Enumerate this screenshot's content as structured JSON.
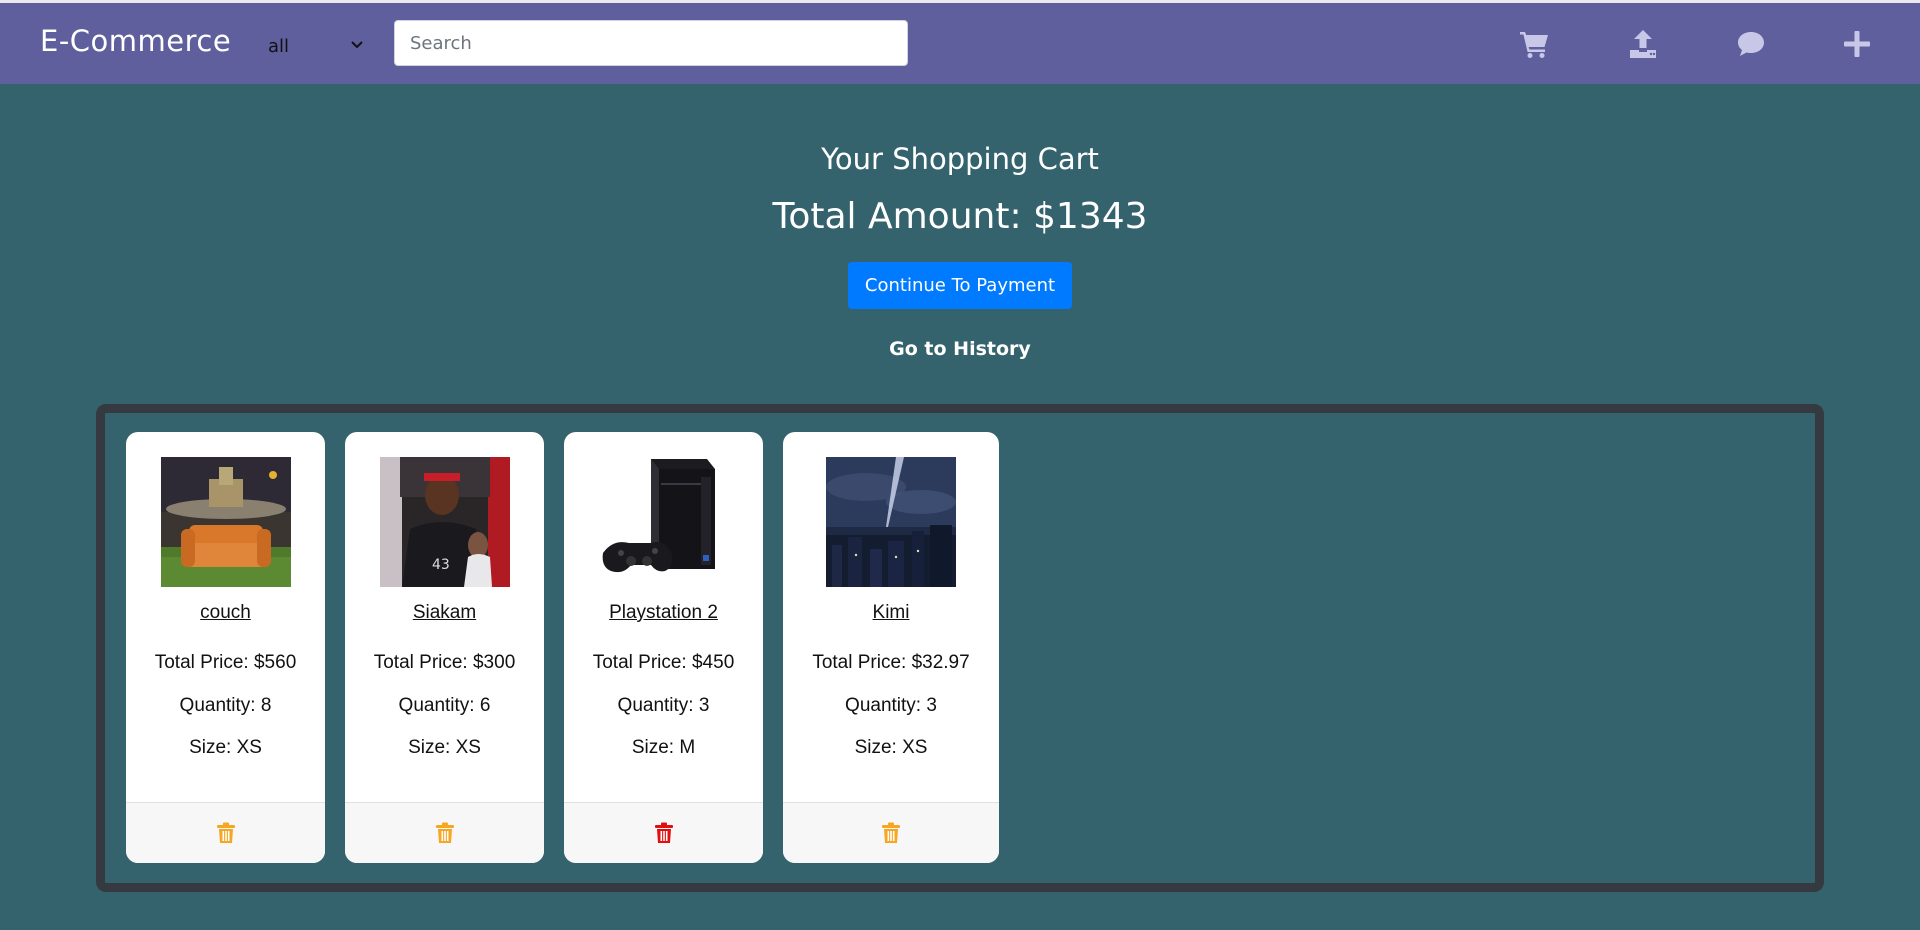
{
  "navbar": {
    "brand": "E-Commerce",
    "category": "all",
    "search_placeholder": "Search",
    "icons": [
      "cart-icon",
      "upload-icon",
      "chat-icon",
      "plus-icon"
    ]
  },
  "main": {
    "title": "Your Shopping Cart",
    "total_amount": "Total Amount: $1343",
    "pay_button": "Continue To Payment",
    "history_link": "Go to History"
  },
  "cart_items": [
    {
      "name": "couch",
      "total_price": "Total Price: $560",
      "quantity": "Quantity: 8",
      "size": "Size: XS",
      "trash_color": "#f5a623"
    },
    {
      "name": "Siakam",
      "total_price": "Total Price: $300",
      "quantity": "Quantity: 6",
      "size": "Size: XS",
      "trash_color": "#f5a623"
    },
    {
      "name": "Playstation 2",
      "total_price": "Total Price: $450",
      "quantity": "Quantity: 3",
      "size": "Size: M",
      "trash_color": "#e01010"
    },
    {
      "name": "Kimi",
      "total_price": "Total Price: $32.97",
      "quantity": "Quantity: 3",
      "size": "Size: XS",
      "trash_color": "#f5a623"
    }
  ],
  "colors": {
    "navbar": "#605f9d",
    "background": "#35636d",
    "primary_button": "#007bff"
  }
}
